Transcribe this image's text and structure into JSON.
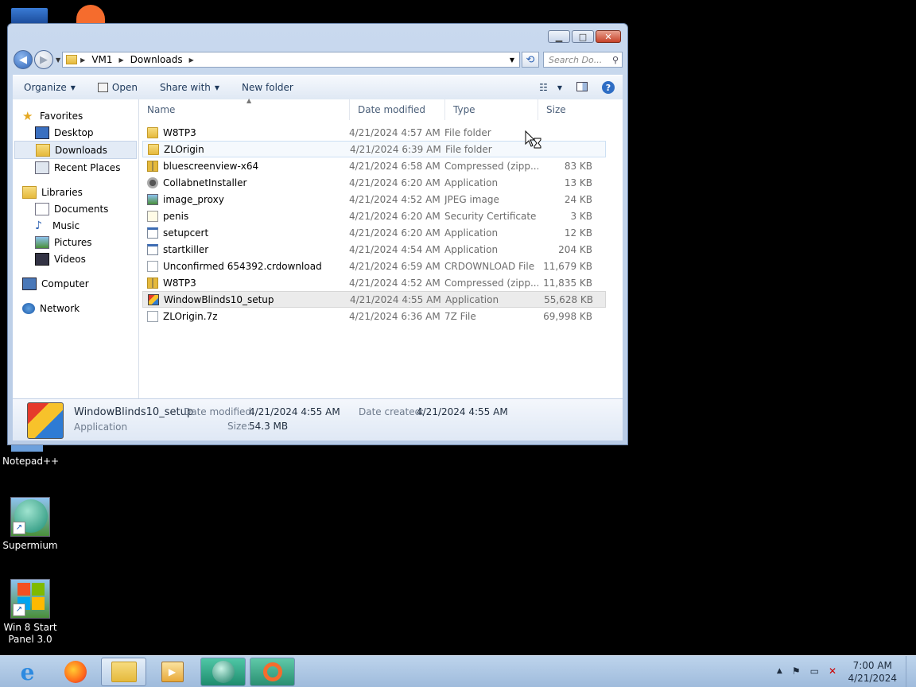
{
  "desktop": {
    "icons": [
      {
        "label": "Notepad++"
      },
      {
        "label": "Supermium"
      },
      {
        "label": "Win 8 Start Panel 3.0"
      }
    ]
  },
  "window": {
    "address": {
      "segments": [
        "VM1",
        "Downloads"
      ]
    },
    "search_placeholder": "Search Do...",
    "toolbar": {
      "organize": "Organize",
      "open": "Open",
      "share_with": "Share with",
      "new_folder": "New folder"
    },
    "nav": {
      "favorites": {
        "label": "Favorites",
        "items": [
          "Desktop",
          "Downloads",
          "Recent Places"
        ]
      },
      "libraries": {
        "label": "Libraries",
        "items": [
          "Documents",
          "Music",
          "Pictures",
          "Videos"
        ]
      },
      "computer": "Computer",
      "network": "Network"
    },
    "columns": {
      "name": "Name",
      "date": "Date modified",
      "type": "Type",
      "size": "Size"
    },
    "files": [
      {
        "name": "W8TP3",
        "date": "4/21/2024 4:57 AM",
        "type": "File folder",
        "size": "",
        "icon": "folder"
      },
      {
        "name": "ZLOrigin",
        "date": "4/21/2024 6:39 AM",
        "type": "File folder",
        "size": "",
        "icon": "folder"
      },
      {
        "name": "bluescreenview-x64",
        "date": "4/21/2024 6:58 AM",
        "type": "Compressed (zipp...",
        "size": "83 KB",
        "icon": "zip"
      },
      {
        "name": "CollabnetInstaller",
        "date": "4/21/2024 6:20 AM",
        "type": "Application",
        "size": "13 KB",
        "icon": "gear"
      },
      {
        "name": "image_proxy",
        "date": "4/21/2024 4:52 AM",
        "type": "JPEG image",
        "size": "24 KB",
        "icon": "img"
      },
      {
        "name": "penis",
        "date": "4/21/2024 6:20 AM",
        "type": "Security Certificate",
        "size": "3 KB",
        "icon": "cert"
      },
      {
        "name": "setupcert",
        "date": "4/21/2024 6:20 AM",
        "type": "Application",
        "size": "12 KB",
        "icon": "app"
      },
      {
        "name": "startkiller",
        "date": "4/21/2024 4:54 AM",
        "type": "Application",
        "size": "204 KB",
        "icon": "app"
      },
      {
        "name": "Unconfirmed 654392.crdownload",
        "date": "4/21/2024 6:59 AM",
        "type": "CRDOWNLOAD File",
        "size": "11,679 KB",
        "icon": "doc"
      },
      {
        "name": "W8TP3",
        "date": "4/21/2024 4:52 AM",
        "type": "Compressed (zipp...",
        "size": "11,835 KB",
        "icon": "zip"
      },
      {
        "name": "WindowBlinds10_setup",
        "date": "4/21/2024 4:55 AM",
        "type": "Application",
        "size": "55,628 KB",
        "icon": "wb"
      },
      {
        "name": "ZLOrigin.7z",
        "date": "4/21/2024 6:36 AM",
        "type": "7Z File",
        "size": "69,998 KB",
        "icon": "doc"
      }
    ],
    "details": {
      "name": "WindowBlinds10_setup",
      "type": "Application",
      "date_modified_label": "Date modified:",
      "date_modified": "4/21/2024 4:55 AM",
      "date_created_label": "Date created:",
      "date_created": "4/21/2024 4:55 AM",
      "size_label": "Size:",
      "size": "54.3 MB"
    }
  },
  "taskbar": {
    "clock_time": "7:00 AM",
    "clock_date": "4/21/2024"
  }
}
